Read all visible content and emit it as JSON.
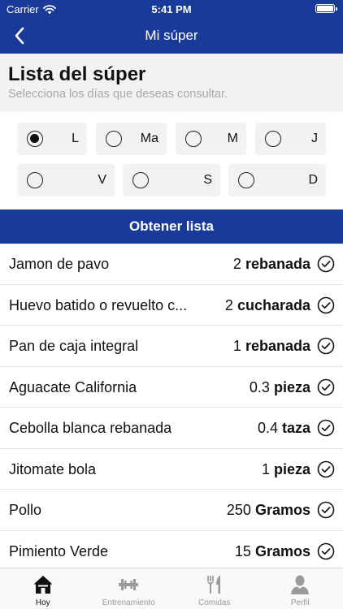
{
  "status_bar": {
    "carrier": "Carrier",
    "time": "5:41 PM"
  },
  "nav": {
    "title": "Mi súper"
  },
  "header": {
    "title": "Lista del súper",
    "subtitle": "Selecciona los días que deseas consultar."
  },
  "days": [
    {
      "label": "L",
      "checked": true
    },
    {
      "label": "Ma",
      "checked": false
    },
    {
      "label": "M",
      "checked": false
    },
    {
      "label": "J",
      "checked": false
    },
    {
      "label": "V",
      "checked": false
    },
    {
      "label": "S",
      "checked": false
    },
    {
      "label": "D",
      "checked": false
    }
  ],
  "get_list_label": "Obtener lista",
  "items": [
    {
      "name": "Jamon de pavo",
      "amount": "2",
      "unit": "rebanada"
    },
    {
      "name": "Huevo batido o revuelto c...",
      "amount": "2",
      "unit": "cucharada"
    },
    {
      "name": "Pan de caja integral",
      "amount": "1",
      "unit": "rebanada"
    },
    {
      "name": "Aguacate California",
      "amount": "0.3",
      "unit": "pieza"
    },
    {
      "name": "Cebolla blanca rebanada",
      "amount": "0.4",
      "unit": "taza"
    },
    {
      "name": "Jitomate bola",
      "amount": "1",
      "unit": "pieza"
    },
    {
      "name": "Pollo",
      "amount": "250",
      "unit": "Gramos"
    },
    {
      "name": "Pimiento Verde",
      "amount": "15",
      "unit": "Gramos"
    }
  ],
  "tabs": [
    {
      "label": "Hoy",
      "icon": "home-icon",
      "active": true
    },
    {
      "label": "Entrenamiento",
      "icon": "dumbbell-icon",
      "active": false
    },
    {
      "label": "Comidas",
      "icon": "fork-knife-icon",
      "active": false
    },
    {
      "label": "Perfil",
      "icon": "person-icon",
      "active": false
    }
  ],
  "colors": {
    "primary": "#1a3a9a",
    "header_bg": "#f2f2f2",
    "subtitle": "#a8a8a8",
    "tab_inactive": "#9a9a9a"
  }
}
